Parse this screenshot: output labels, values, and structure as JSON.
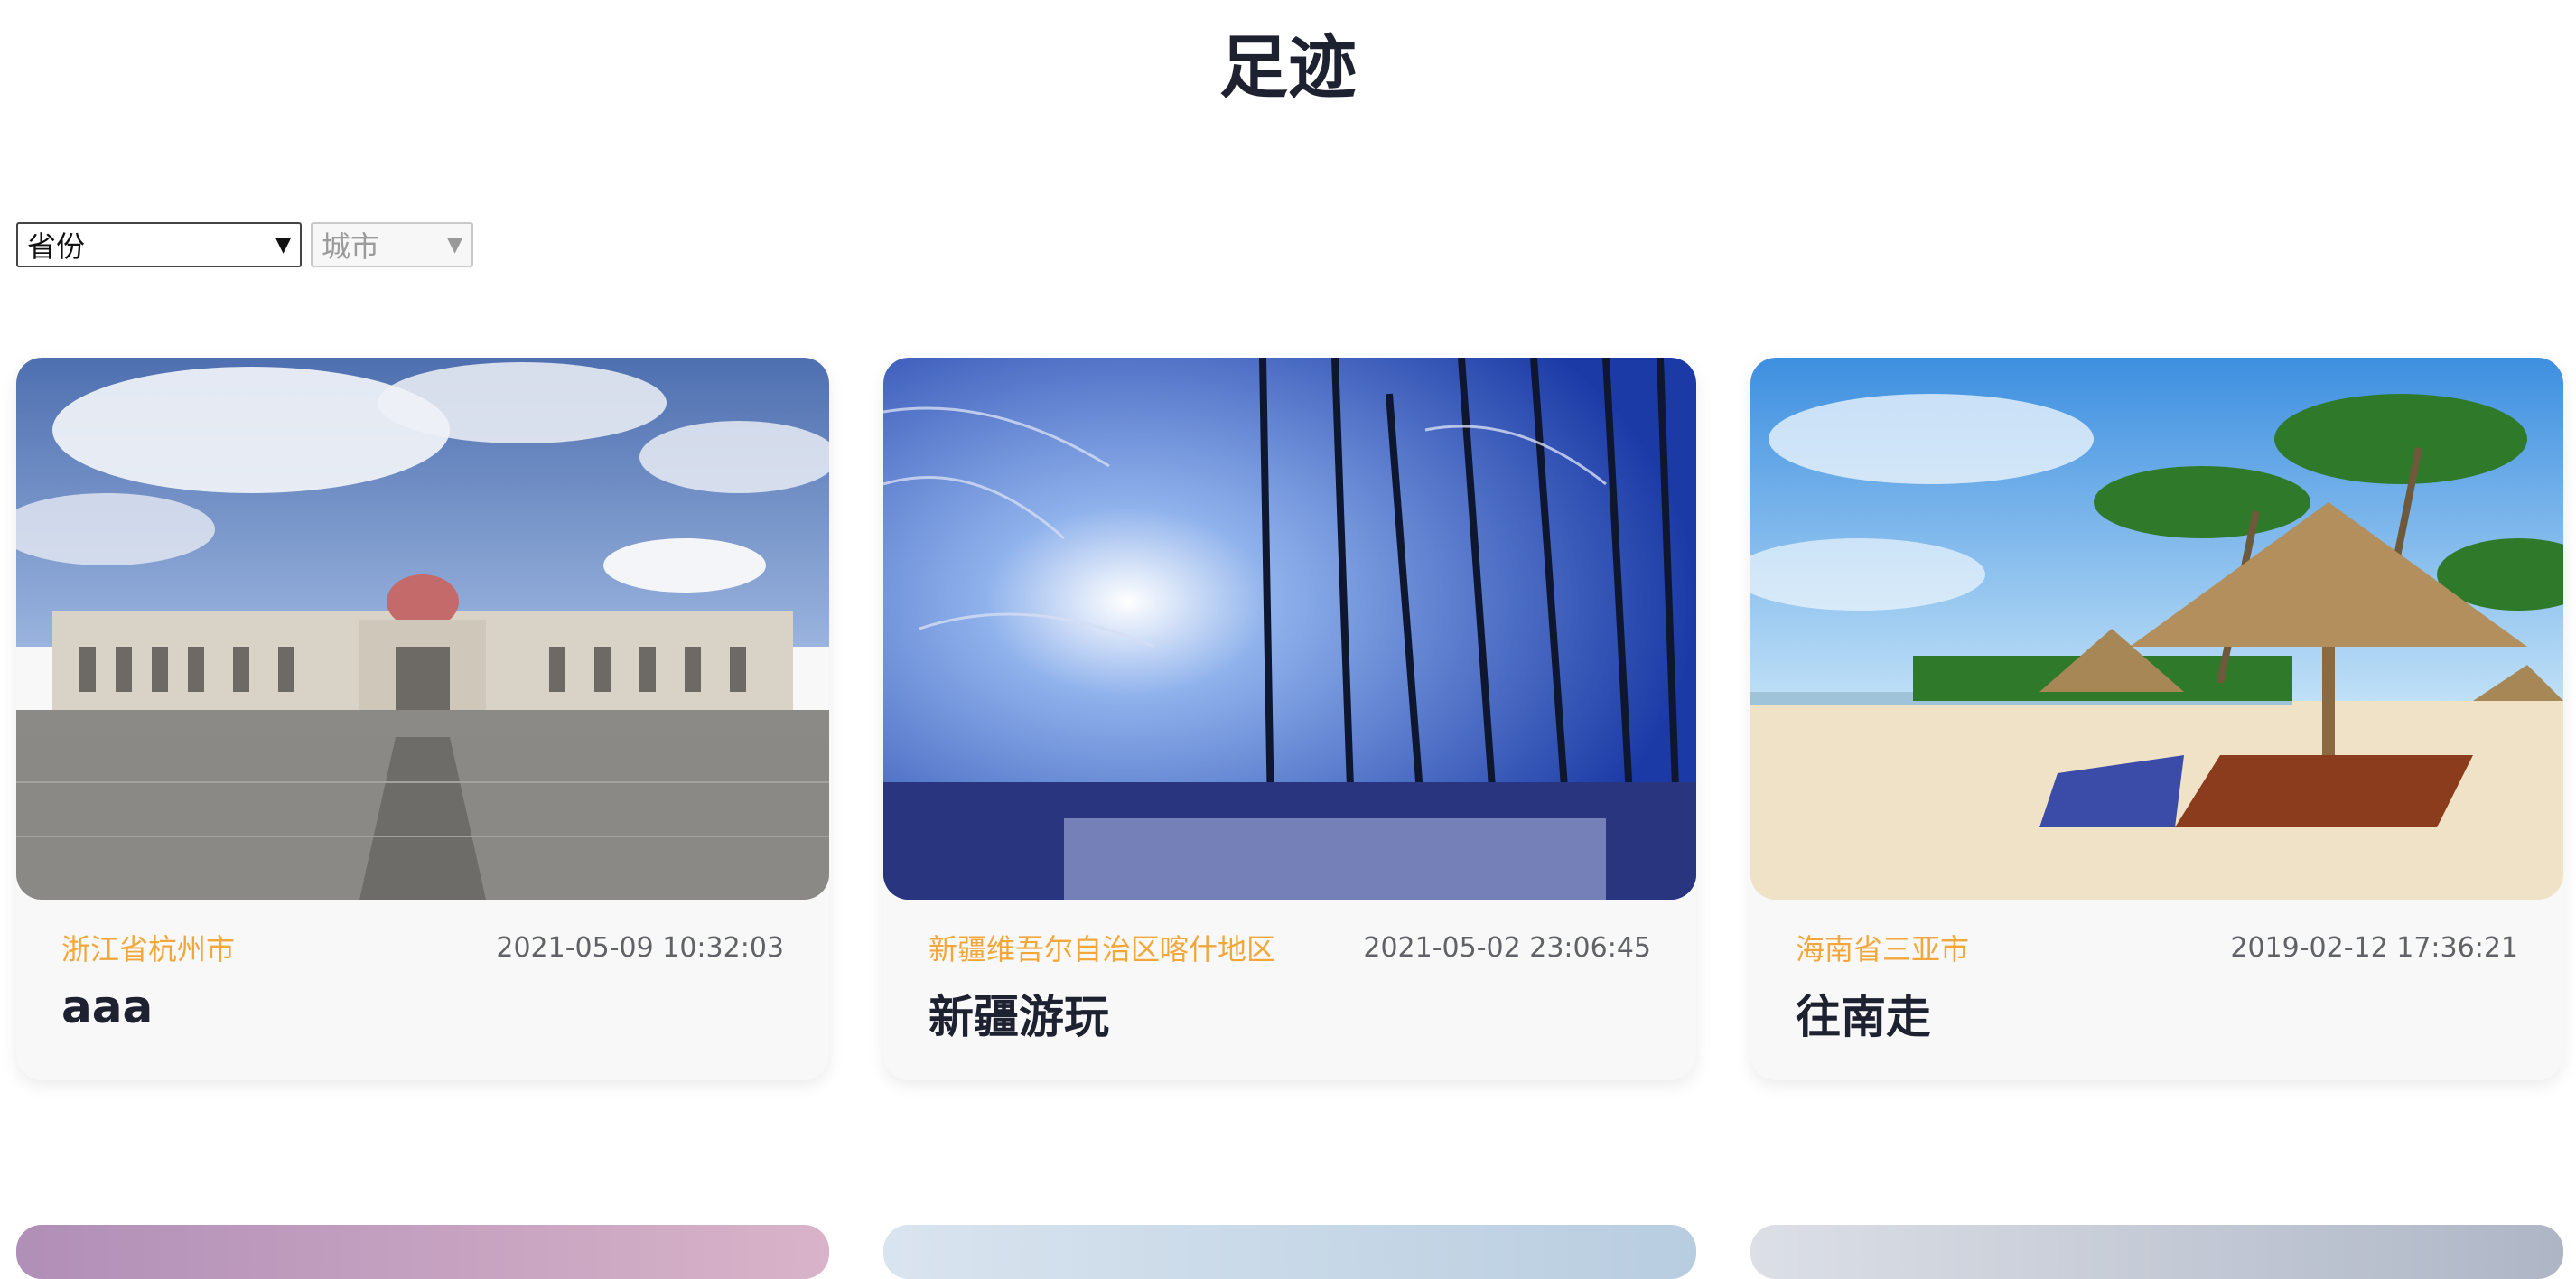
{
  "page": {
    "title": "足迹"
  },
  "filters": {
    "province": {
      "selected": "省份"
    },
    "city": {
      "selected": "城市",
      "disabled": true
    }
  },
  "cards": [
    {
      "place": "浙江省杭州市",
      "time": "2021-05-09 10:32:03",
      "title": "aaa",
      "image": "building-plaza-photo"
    },
    {
      "place": "新疆维吾尔自治区喀什地区",
      "time": "2021-05-02 23:06:45",
      "title": "新疆游玩",
      "image": "snowy-forest-photo"
    },
    {
      "place": "海南省三亚市",
      "time": "2019-02-12 17:36:21",
      "title": "往南走",
      "image": "beach-umbrellas-photo"
    }
  ],
  "colors": {
    "accent": "#f3a73a",
    "text": "#1e2130",
    "muted": "#606266",
    "card_bg": "#f8f8f9"
  }
}
